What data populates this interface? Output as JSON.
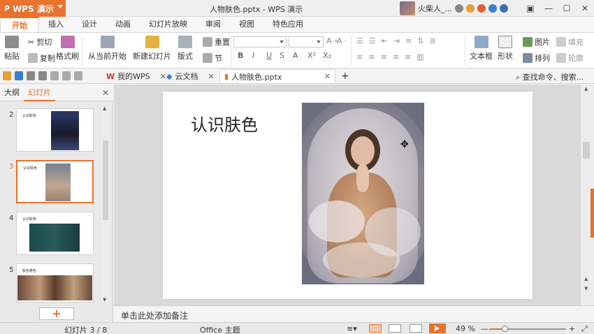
{
  "titlebar": {
    "app_name": "WPS 演示",
    "doc_title": "人物肤色.pptx - WPS 演示",
    "user_name": "火柴人_..."
  },
  "ribbon_tabs": [
    "开始",
    "插入",
    "设计",
    "动画",
    "幻灯片放映",
    "审阅",
    "视图",
    "特色应用"
  ],
  "ribbon": {
    "paste": "粘贴",
    "cut": "剪切",
    "copy": "复制",
    "format_painter": "格式刷",
    "from_current": "从当前开始",
    "new_slide": "新建幻灯片",
    "layout": "版式",
    "reset": "重置",
    "section": "节",
    "text_box": "文本框",
    "shape": "形状",
    "picture": "图片",
    "fill": "填充",
    "arrange": "排列",
    "outline": "轮廓",
    "bold": "B",
    "italic": "I",
    "underline": "U",
    "strike": "S",
    "superscript": "X²",
    "subscript": "X₂",
    "font_color": "A"
  },
  "doc_tabs": [
    {
      "label": "我的WPS"
    },
    {
      "label": "云文档"
    },
    {
      "label": "人物肤色.pptx"
    }
  ],
  "search_command": "查找命令、搜索...",
  "left_panel": {
    "tab_outline": "大纲",
    "tab_slides": "幻灯片",
    "slides": [
      {
        "num": "2",
        "title": "认识肤色"
      },
      {
        "num": "3",
        "title": "认识肤色"
      },
      {
        "num": "4",
        "title": "认识肤色"
      },
      {
        "num": "5",
        "title": "肤色着色"
      }
    ]
  },
  "slide": {
    "title": "认识肤色"
  },
  "notes_placeholder": "单击此处添加备注",
  "status": {
    "slide_counter": "幻灯片 3 / 8",
    "theme": "Office 主题",
    "zoom": "49 %",
    "zoom_level": 0.2
  },
  "colors": {
    "accent": "#e8722e"
  }
}
